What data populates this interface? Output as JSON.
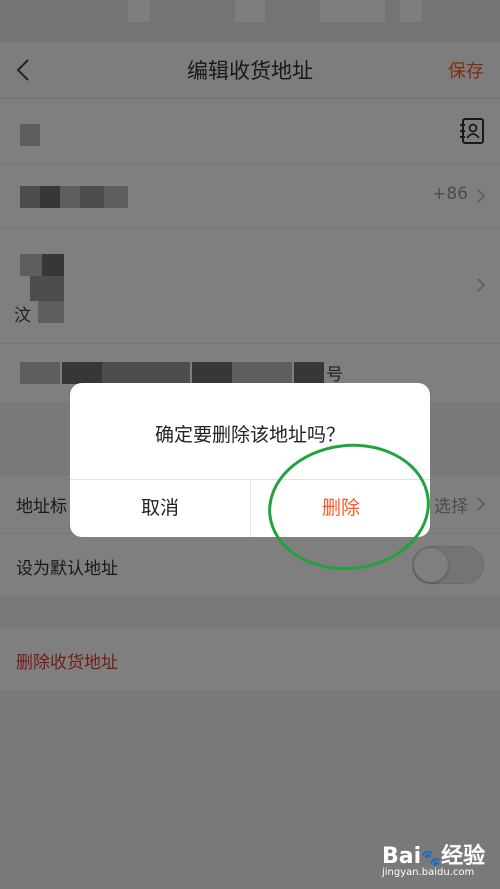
{
  "nav": {
    "title": "编辑收货地址",
    "save_label": "保存"
  },
  "form": {
    "phone_prefix": "+86",
    "region_partial": "汶",
    "house_number_suffix": "号"
  },
  "settings": {
    "tag_label": "地址标",
    "tag_hint": "选择",
    "default_label": "设为默认地址",
    "default_enabled": false
  },
  "delete_link": "删除收货地址",
  "dialog": {
    "message": "确定要删除该地址吗？",
    "cancel_label": "取消",
    "confirm_label": "删除"
  },
  "watermark": {
    "brand": "Bai",
    "brand_suffix": "经验",
    "url": "jingyan.baidu.com"
  },
  "colors": {
    "accent": "#ff5a1f",
    "danger": "#e23b2e",
    "annotation": "#22a33a"
  }
}
